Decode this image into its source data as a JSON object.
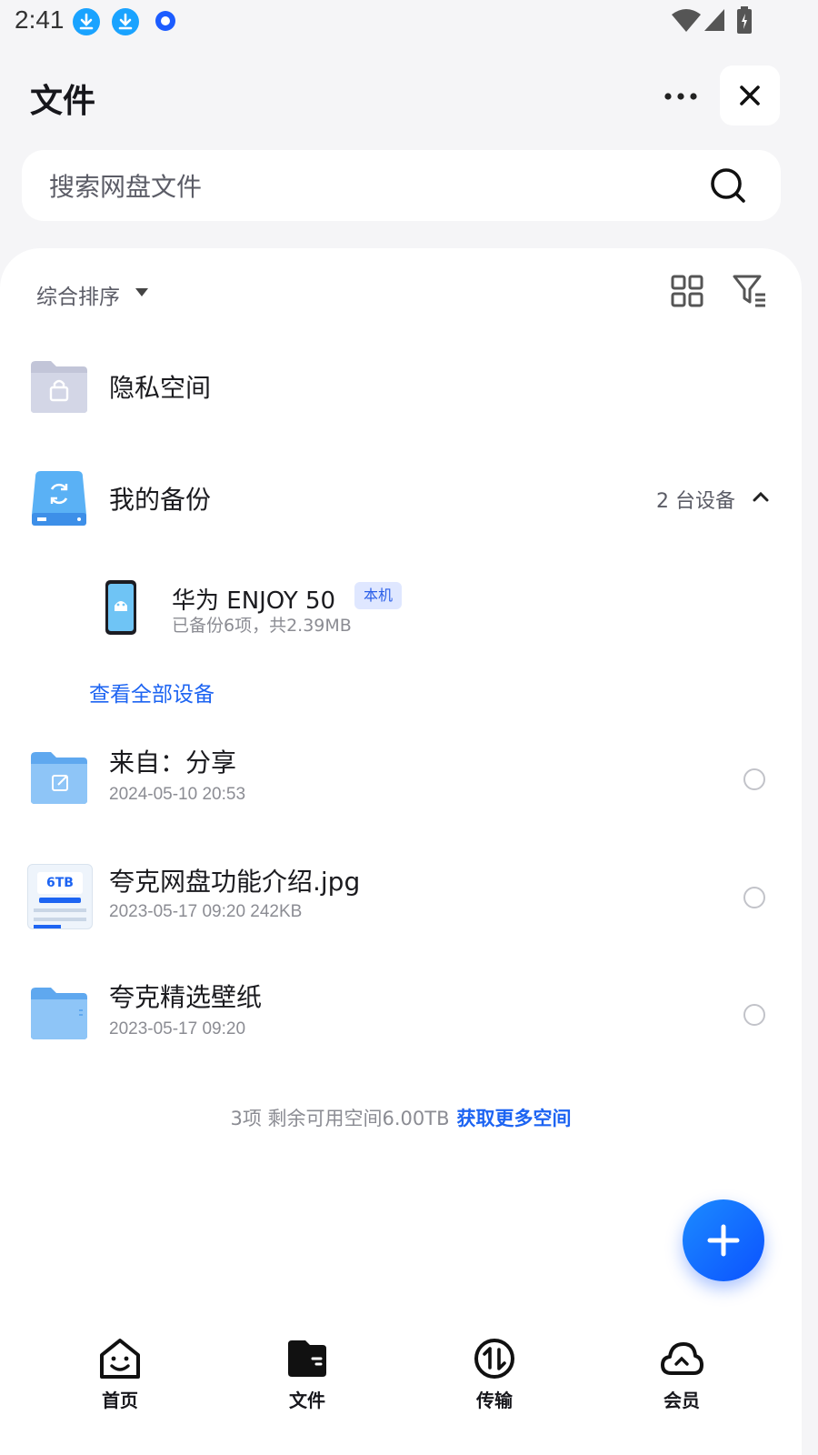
{
  "status_bar": {
    "time": "2:41"
  },
  "header": {
    "title": "文件"
  },
  "search": {
    "placeholder": "搜索网盘文件"
  },
  "toolbar": {
    "sort_label": "综合排序"
  },
  "items": {
    "privacy": {
      "title": "隐私空间"
    },
    "backup": {
      "title": "我的备份",
      "devices_count": "2 台设备"
    },
    "device": {
      "name": "华为 ENJOY 50",
      "badge": "本机",
      "subtitle": "已备份6项，共2.39MB"
    },
    "view_all": "查看全部设备",
    "files": [
      {
        "title": "来自：分享",
        "meta": "2024-05-10 20:53"
      },
      {
        "title": "夸克网盘功能介绍.jpg",
        "meta": "2023-05-17 09:20  242KB",
        "thumb_text": "6TB"
      },
      {
        "title": "夸克精选壁纸",
        "meta": "2023-05-17 09:20"
      }
    ]
  },
  "footer": {
    "summary": "3项 剩余可用空间6.00TB",
    "link": "获取更多空间"
  },
  "nav": [
    {
      "label": "首页",
      "icon": "home-face-icon"
    },
    {
      "label": "文件",
      "icon": "folder-icon"
    },
    {
      "label": "传输",
      "icon": "transfer-icon"
    },
    {
      "label": "会员",
      "icon": "cloud-icon"
    }
  ],
  "colors": {
    "accent": "#1d64f2",
    "fab": "#0b52ff",
    "background": "#f5f5f7"
  }
}
